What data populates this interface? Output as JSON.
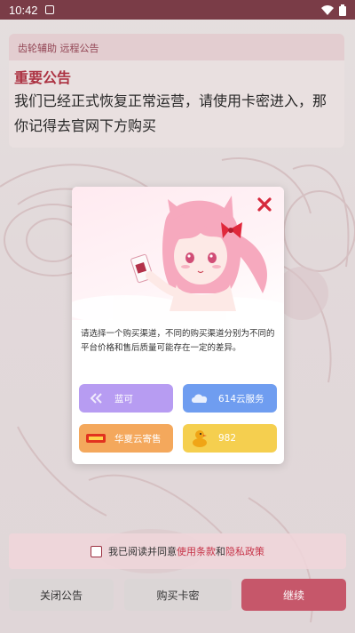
{
  "status_bar": {
    "time": "10:42",
    "icons": [
      "notification-icon",
      "wifi-icon",
      "battery-icon"
    ]
  },
  "announcement": {
    "header": "齿轮辅助 远程公告",
    "title": "重要公告",
    "body": "我们已经正式恢复正常运营，请使用卡密进入，那你记得去官网下方购买"
  },
  "dialog": {
    "description": "请选择一个购买渠道，不同的购买渠道分别为不同的平台价格和售后质量可能存在一定的差异。",
    "options": [
      {
        "label": "蓝可",
        "icon": "double-chevron-icon",
        "color": "#b79cf2"
      },
      {
        "label": "614云服务",
        "icon": "cloud-logo-icon",
        "color": "#6f9df0"
      },
      {
        "label": "华夏云寄售",
        "icon": "huaxia-logo-icon",
        "color": "#f4a85c"
      },
      {
        "label": "982",
        "icon": "duck-icon",
        "color": "#f5cf4f"
      }
    ]
  },
  "agreement": {
    "prefix": "我已阅读并同意",
    "terms": "使用条款",
    "and": "和",
    "privacy": "隐私政策"
  },
  "buttons": {
    "close": "关闭公告",
    "buy": "购买卡密",
    "continue": "继续"
  },
  "colors": {
    "accent": "#b73647",
    "continue": "#c6576a"
  }
}
